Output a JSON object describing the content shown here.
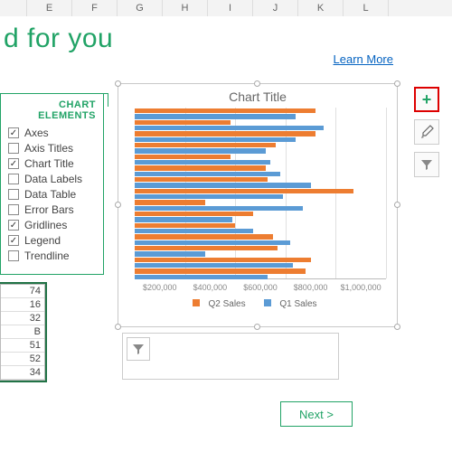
{
  "columns": [
    "",
    "E",
    "F",
    "G",
    "H",
    "I",
    "J",
    "K",
    "L"
  ],
  "title_fragment": "d for you",
  "learn_more": "Learn More",
  "chart_elements": {
    "title": "CHART ELEMENTS",
    "items": [
      {
        "label": "Axes",
        "checked": true
      },
      {
        "label": "Axis Titles",
        "checked": false
      },
      {
        "label": "Chart Title",
        "checked": true
      },
      {
        "label": "Data Labels",
        "checked": false
      },
      {
        "label": "Data Table",
        "checked": false
      },
      {
        "label": "Error Bars",
        "checked": false
      },
      {
        "label": "Gridlines",
        "checked": true
      },
      {
        "label": "Legend",
        "checked": true
      },
      {
        "label": "Trendline",
        "checked": false
      }
    ]
  },
  "visible_cells": [
    "74",
    "16",
    "32",
    "B",
    "51",
    "52",
    "34"
  ],
  "next_label": "Next  >",
  "legend_labels": {
    "q2": "Q2 Sales",
    "q1": "Q1 Sales"
  },
  "colors": {
    "q2": "#ed7d31",
    "q1": "#5b9bd5",
    "accent": "#21a366"
  },
  "chart_data": {
    "type": "bar",
    "orientation": "horizontal",
    "title": "Chart Title",
    "xlabel": "",
    "ylabel": "",
    "xlim": [
      0,
      1000000
    ],
    "x_ticks": [
      "$200,000",
      "$400,000",
      "$600,000",
      "$800,000",
      "$1,000,000"
    ],
    "series": [
      {
        "name": "Q2 Sales",
        "values": [
          720000,
          380000,
          720000,
          560000,
          380000,
          520000,
          530000,
          870000,
          280000,
          470000,
          400000,
          550000,
          570000,
          700000,
          680000
        ]
      },
      {
        "name": "Q1 Sales",
        "values": [
          640000,
          750000,
          640000,
          520000,
          540000,
          580000,
          700000,
          590000,
          670000,
          390000,
          470000,
          620000,
          280000,
          630000,
          530000
        ]
      }
    ],
    "legend_position": "bottom",
    "grid": true
  }
}
